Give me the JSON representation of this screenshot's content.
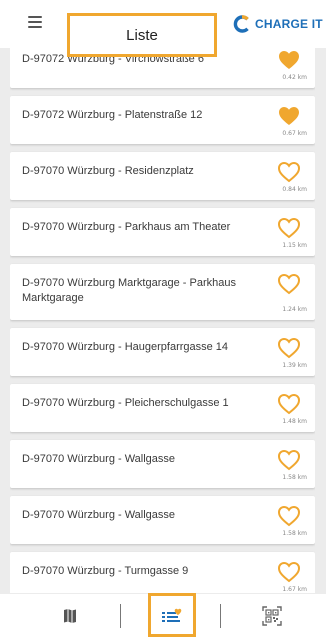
{
  "header": {
    "title": "Liste",
    "brand_name": "CHARGE IT",
    "menu_icon": "hamburger-menu-icon",
    "logo_icon": "charge-it-logo-icon"
  },
  "colors": {
    "accent": "#f0a72f",
    "brand_blue": "#1e6fb8",
    "background": "#ececec"
  },
  "stations": [
    {
      "name": "D-97072 Würzburg - Virchowstraße 6",
      "distance": "0.42 km",
      "favorite": true
    },
    {
      "name": "D-97072 Würzburg - Platenstraße 12",
      "distance": "0.67 km",
      "favorite": true
    },
    {
      "name": "D-97070 Würzburg - Residenzplatz",
      "distance": "0.84 km",
      "favorite": false
    },
    {
      "name": "D-97070 Würzburg - Parkhaus am Theater",
      "distance": "1.15 km",
      "favorite": false
    },
    {
      "name": "D-97070 Würzburg Marktgarage - Parkhaus Marktgarage",
      "distance": "1.24 km",
      "favorite": false
    },
    {
      "name": "D-97070 Würzburg - Haugerpfarrgasse 14",
      "distance": "1.39 km",
      "favorite": false
    },
    {
      "name": "D-97070 Würzburg - Pleicherschulgasse 1",
      "distance": "1.48 km",
      "favorite": false
    },
    {
      "name": "D-97070 Würzburg - Wallgasse",
      "distance": "1.58 km",
      "favorite": false
    },
    {
      "name": "D-97070 Würzburg - Wallgasse",
      "distance": "1.58 km",
      "favorite": false
    },
    {
      "name": "D-97070 Würzburg - Turmgasse 9",
      "distance": "1.67 km",
      "favorite": false
    }
  ],
  "bottom_nav": {
    "items": [
      {
        "name": "map",
        "icon": "map-icon",
        "active": false
      },
      {
        "name": "list",
        "icon": "list-heart-icon",
        "active": true
      },
      {
        "name": "qr",
        "icon": "qr-code-icon",
        "active": false
      }
    ]
  }
}
